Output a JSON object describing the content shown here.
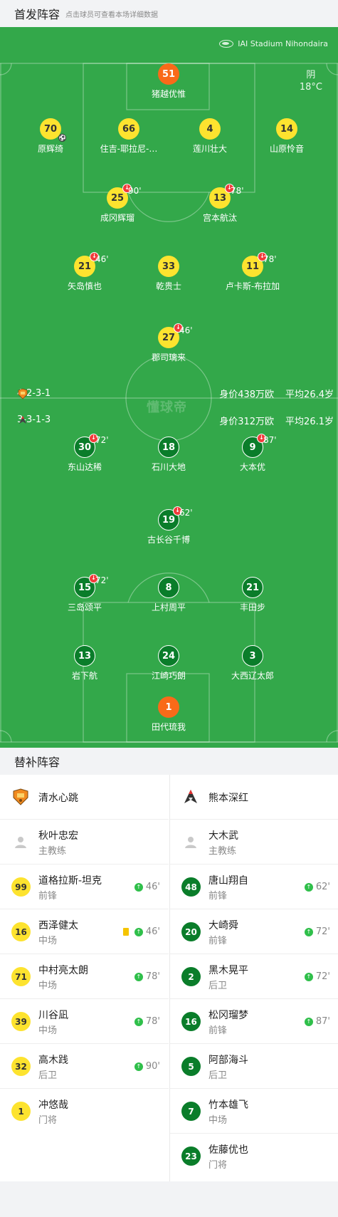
{
  "header": {
    "title": "首发阵容",
    "hint": "点击球员可查看本场详细数据"
  },
  "match": {
    "stadium": "IAI Stadium Nihondaira",
    "weather": "阴",
    "temperature": "18°C",
    "watermark": "懂球帝"
  },
  "home": {
    "formation": "4-2-3-1",
    "market_value": "身价438万欧",
    "avg_age": "平均26.4岁",
    "players": [
      {
        "num": "51",
        "name": "猪越优惟",
        "color": "orange",
        "sub": "",
        "ball": false
      },
      {
        "num": "70",
        "name": "原辉绮",
        "color": "yellow",
        "sub": "",
        "ball": true
      },
      {
        "num": "66",
        "name": "住吉-耶拉尼-…",
        "color": "yellow",
        "sub": "",
        "ball": false
      },
      {
        "num": "4",
        "name": "莲川壮大",
        "color": "yellow",
        "sub": "",
        "ball": false
      },
      {
        "num": "14",
        "name": "山原怜音",
        "color": "yellow",
        "sub": "",
        "ball": false
      },
      {
        "num": "25",
        "name": "成冈辉瑠",
        "color": "yellow",
        "sub": "90'",
        "ball": false
      },
      {
        "num": "13",
        "name": "宫本航汰",
        "color": "yellow",
        "sub": "78'",
        "ball": false
      },
      {
        "num": "21",
        "name": "矢岛慎也",
        "color": "yellow",
        "sub": "46'",
        "ball": false
      },
      {
        "num": "33",
        "name": "乾贵士",
        "color": "yellow",
        "sub": "",
        "ball": false
      },
      {
        "num": "11",
        "name": "卢卡斯-布拉加",
        "color": "yellow",
        "sub": "78'",
        "ball": false
      },
      {
        "num": "27",
        "name": "郡司璃来",
        "color": "yellow",
        "sub": "46'",
        "ball": false
      }
    ]
  },
  "away": {
    "formation": "3-3-1-3",
    "market_value": "身价312万欧",
    "avg_age": "平均26.1岁",
    "players": [
      {
        "num": "30",
        "name": "东山达稀",
        "color": "green",
        "sub": "72'",
        "ball": false
      },
      {
        "num": "18",
        "name": "石川大地",
        "color": "green",
        "sub": "",
        "ball": false
      },
      {
        "num": "9",
        "name": "大本优",
        "color": "green",
        "sub": "87'",
        "ball": false
      },
      {
        "num": "19",
        "name": "古长谷千博",
        "color": "green",
        "sub": "62'",
        "ball": false
      },
      {
        "num": "15",
        "name": "三岛颂平",
        "color": "green",
        "sub": "72'",
        "ball": false
      },
      {
        "num": "8",
        "name": "上村周平",
        "color": "green",
        "sub": "",
        "ball": false
      },
      {
        "num": "21",
        "name": "丰田步",
        "color": "green",
        "sub": "",
        "ball": false
      },
      {
        "num": "13",
        "name": "岩下航",
        "color": "green",
        "sub": "",
        "ball": false
      },
      {
        "num": "24",
        "name": "江崎巧朗",
        "color": "green",
        "sub": "",
        "ball": false
      },
      {
        "num": "3",
        "name": "大西辽太郎",
        "color": "green",
        "sub": "",
        "ball": false
      },
      {
        "num": "1",
        "name": "田代琉我",
        "color": "orange",
        "sub": "",
        "ball": false
      }
    ]
  },
  "subs": {
    "title": "替补阵容",
    "home": {
      "team": "清水心跳",
      "coach": {
        "name": "秋叶忠宏",
        "role": "主教练"
      },
      "players": [
        {
          "num": "99",
          "name": "道格拉斯-坦克",
          "role": "前锋",
          "minute": "46'",
          "card": false
        },
        {
          "num": "16",
          "name": "西泽健太",
          "role": "中场",
          "minute": "46'",
          "card": true
        },
        {
          "num": "71",
          "name": "中村亮太朗",
          "role": "中场",
          "minute": "78'",
          "card": false
        },
        {
          "num": "39",
          "name": "川谷凪",
          "role": "中场",
          "minute": "78'",
          "card": false
        },
        {
          "num": "32",
          "name": "高木践",
          "role": "后卫",
          "minute": "90'",
          "card": false
        },
        {
          "num": "1",
          "name": "冲悠哉",
          "role": "门将",
          "minute": "",
          "card": false
        }
      ]
    },
    "away": {
      "team": "熊本深红",
      "coach": {
        "name": "大木武",
        "role": "主教练"
      },
      "players": [
        {
          "num": "48",
          "name": "唐山翔自",
          "role": "前锋",
          "minute": "62'",
          "card": false
        },
        {
          "num": "20",
          "name": "大崎舜",
          "role": "前锋",
          "minute": "72'",
          "card": false
        },
        {
          "num": "2",
          "name": "黑木晃平",
          "role": "后卫",
          "minute": "72'",
          "card": false
        },
        {
          "num": "16",
          "name": "松冈瑠梦",
          "role": "前锋",
          "minute": "87'",
          "card": false
        },
        {
          "num": "5",
          "name": "阿部海斗",
          "role": "后卫",
          "minute": "",
          "card": false
        },
        {
          "num": "7",
          "name": "竹本雄飞",
          "role": "中场",
          "minute": "",
          "card": false
        },
        {
          "num": "23",
          "name": "佐藤优也",
          "role": "门将",
          "minute": "",
          "card": false
        }
      ]
    }
  }
}
